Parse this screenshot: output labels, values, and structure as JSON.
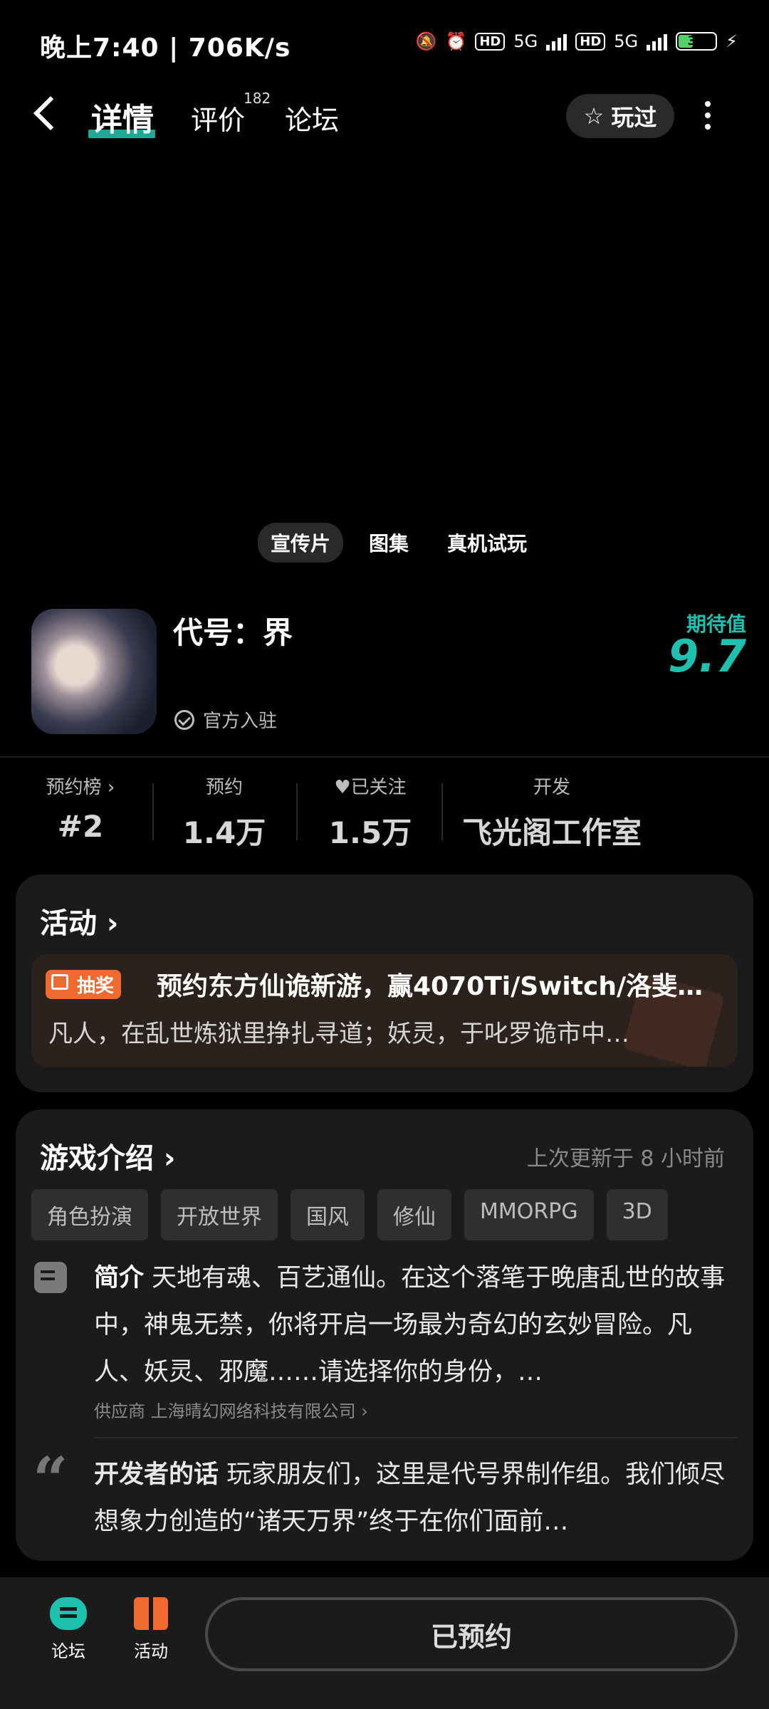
{
  "status_bar": {
    "time_speed": "晚上7:40 | 706K/s",
    "net1": "5G",
    "net2": "5G",
    "battery": "37"
  },
  "header": {
    "tabs": [
      {
        "label": "详情"
      },
      {
        "label": "评价"
      },
      {
        "label": "论坛"
      }
    ],
    "review_count": "182",
    "played_label": "玩过"
  },
  "media_tabs": [
    "宣传片",
    "图集",
    "真机试玩"
  ],
  "game": {
    "title": "代号：界",
    "official_label": "官方入驻",
    "expect_label": "期待值",
    "expect_score": "9.7"
  },
  "stats": [
    {
      "label": "预约榜",
      "value": "#2"
    },
    {
      "label": "预约",
      "value": "1.4万"
    },
    {
      "label": "已关注",
      "value": "1.5万"
    },
    {
      "label": "开发",
      "value": "飞光阁工作室"
    }
  ],
  "activity": {
    "title": "活动",
    "badge": "抽奖",
    "headline": "预约东方仙诡新游，赢4070Ti/Switch/洛斐…",
    "desc": "凡人，在乱世炼狱里挣扎寻道；妖灵，于叱罗诡市中…"
  },
  "intro": {
    "title": "游戏介绍",
    "updated": "上次更新于 8 小时前",
    "tags": [
      "角色扮演",
      "开放世界",
      "国风",
      "修仙",
      "MMORPG",
      "3D"
    ],
    "summary_label": "简介",
    "summary": "天地有魂、百艺通仙。在这个落笔于晚唐乱世的故事中，神鬼无禁，你将开启一场最为奇幻的玄妙冒险。凡人、妖灵、邪魔……请选择你的身份，…",
    "supplier": "供应商 上海晴幻网络科技有限公司",
    "dev_label": "开发者的话",
    "dev_words": "玩家朋友们，这里是代号界制作组。我们倾尽想象力创造的“诸天万界”终于在你们面前…"
  },
  "bottom_bar": {
    "forum": "论坛",
    "activity": "活动",
    "reserved": "已预约"
  },
  "colors": {
    "accent": "#1ec1b0",
    "orange": "#f06a2f"
  }
}
